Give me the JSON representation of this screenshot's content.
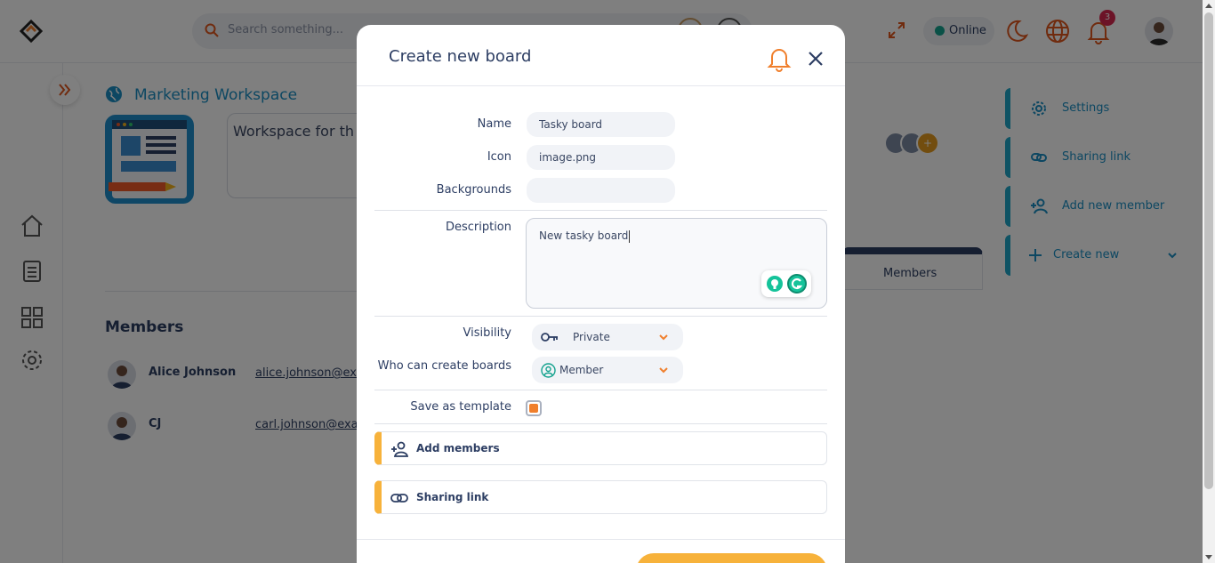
{
  "topbar": {
    "search_placeholder": "Search something...",
    "status_label": "Online",
    "notification_count": "3"
  },
  "workspace": {
    "title": "Marketing Workspace",
    "description": "Workspace for th",
    "members_heading": "Members",
    "members_tab": "Members",
    "members": [
      {
        "name": "Alice Johnson",
        "email": "alice.johnson@exam"
      },
      {
        "name": "CJ",
        "email": "carl.johnson@exam"
      }
    ]
  },
  "right_panel": {
    "items": [
      {
        "label": "Settings",
        "icon": "gear-icon"
      },
      {
        "label": "Sharing link",
        "icon": "link-icon"
      },
      {
        "label": "Add new member",
        "icon": "add-user-icon"
      },
      {
        "label": "Create new",
        "icon": "plus-icon"
      }
    ]
  },
  "modal": {
    "title": "Create new board",
    "fields": {
      "name_label": "Name",
      "name_value": "Tasky board",
      "icon_label": "Icon",
      "icon_value": "image.png",
      "backgrounds_label": "Backgrounds",
      "backgrounds_value": "",
      "description_label": "Description",
      "description_value": "New tasky board",
      "visibility_label": "Visibility",
      "visibility_value": "Private",
      "who_can_create_label": "Who can create boards",
      "who_can_create_value": "Member",
      "save_template_label": "Save as template"
    },
    "sections": {
      "add_members": "Add members",
      "sharing_link": "Sharing link"
    }
  },
  "colors": {
    "accent_orange": "#f07f2c",
    "accent_yellow": "#f7b23b",
    "brand_blue": "#1a8fc4",
    "text_navy": "#2d3e63",
    "online_green": "#14a28e"
  }
}
